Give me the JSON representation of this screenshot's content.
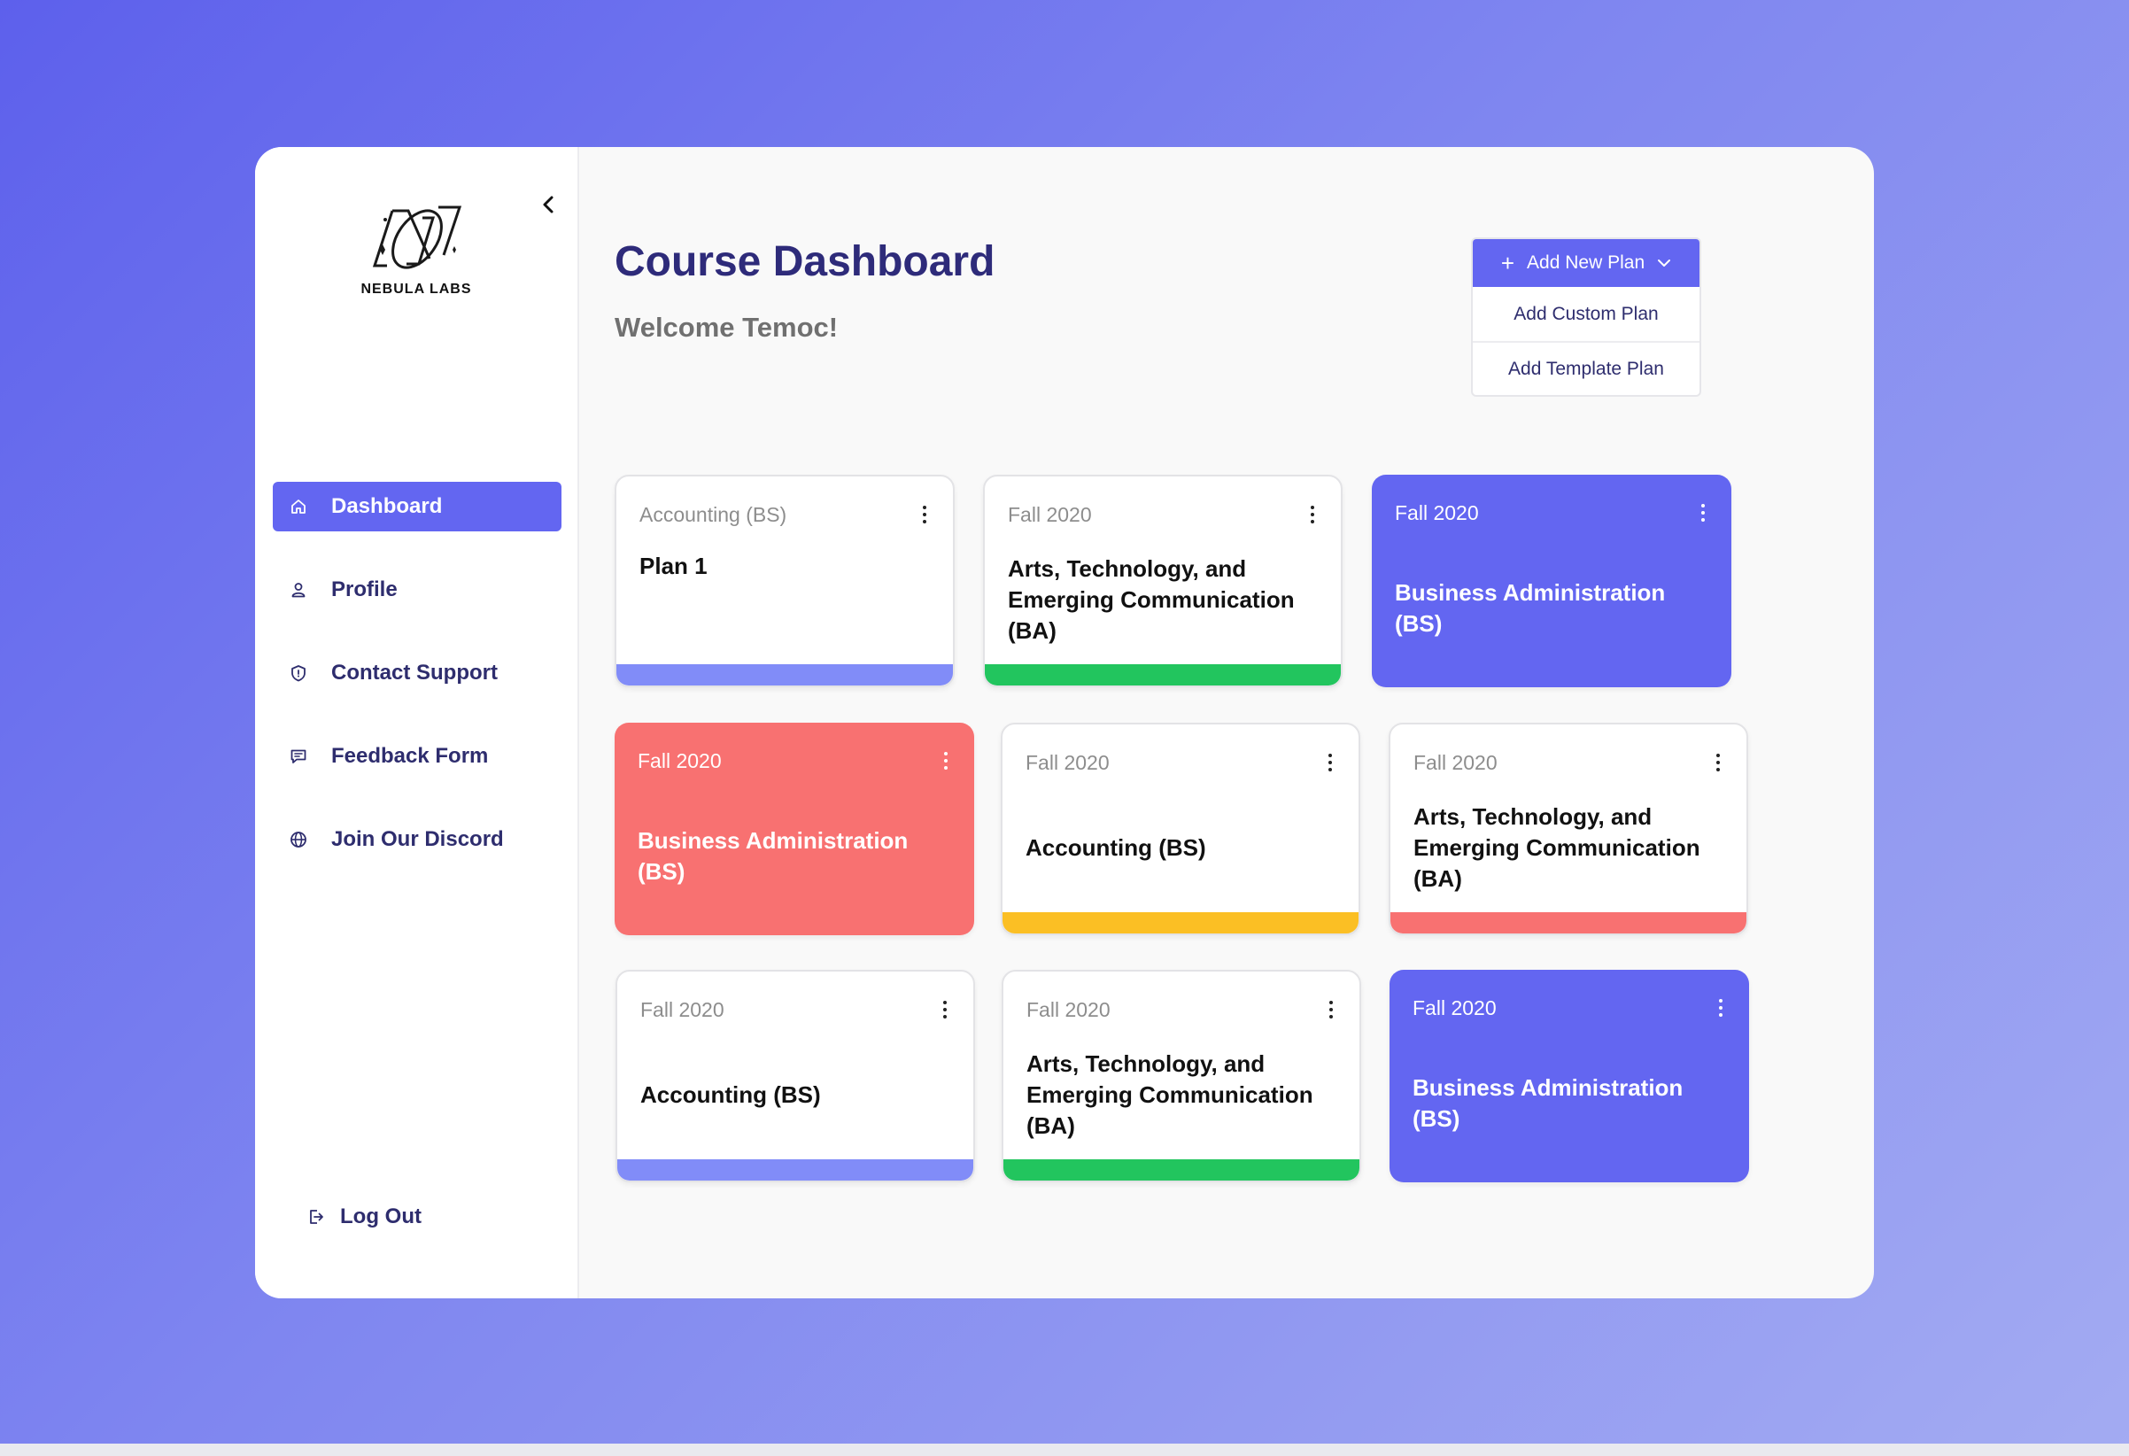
{
  "app": {
    "logo_text": "NEBULA LABS"
  },
  "nav": {
    "items": [
      {
        "label": "Dashboard",
        "icon": "home-icon",
        "active": true
      },
      {
        "label": "Profile",
        "icon": "user-icon"
      },
      {
        "label": "Contact Support",
        "icon": "shield-icon"
      },
      {
        "label": "Feedback Form",
        "icon": "chat-icon"
      },
      {
        "label": "Join Our Discord",
        "icon": "globe-icon"
      }
    ],
    "logout": "Log Out"
  },
  "header": {
    "title": "Course Dashboard",
    "welcome": "Welcome Temoc!"
  },
  "add_plan": {
    "button_label": "Add New Plan",
    "options": [
      "Add Custom Plan",
      "Add Template Plan"
    ]
  },
  "colors": {
    "accent": "#6366f1",
    "bar_periwinkle": "#818cf8",
    "bar_green": "#22c55e",
    "bar_yellow": "#fbbf24",
    "bar_red": "#f87171",
    "card_red": "#f87171",
    "card_purple": "#6366f1"
  },
  "plans": [
    {
      "term": "Accounting (BS)",
      "title_lines": [
        "Plan  1"
      ],
      "style": "bar",
      "color": "#818cf8"
    },
    {
      "term": "Fall 2020",
      "title_lines": [
        "Arts, Technology, and",
        "Emerging Communication",
        "(BA)"
      ],
      "style": "bar",
      "color": "#22c55e"
    },
    {
      "term": "Fall 2020",
      "title_lines": [
        "Business Administration",
        "(BS)"
      ],
      "style": "filled",
      "color": "#6366f1"
    },
    {
      "term": "Fall 2020",
      "title_lines": [
        "Business Administration",
        "(BS)"
      ],
      "style": "filled",
      "color": "#f87171"
    },
    {
      "term": "Fall 2020",
      "title_lines": [
        "Accounting (BS)"
      ],
      "style": "bar",
      "color": "#fbbf24"
    },
    {
      "term": "Fall 2020",
      "title_lines": [
        "Arts, Technology, and",
        "Emerging Communication",
        "(BA)"
      ],
      "style": "bar",
      "color": "#f87171"
    },
    {
      "term": "Fall 2020",
      "title_lines": [
        "Accounting (BS)"
      ],
      "style": "bar",
      "color": "#818cf8"
    },
    {
      "term": "Fall 2020",
      "title_lines": [
        "Arts, Technology, and",
        "Emerging Communication",
        "(BA)"
      ],
      "style": "bar",
      "color": "#22c55e"
    },
    {
      "term": "Fall 2020",
      "title_lines": [
        "Business Administration",
        "(BS)"
      ],
      "style": "filled",
      "color": "#6366f1"
    }
  ]
}
